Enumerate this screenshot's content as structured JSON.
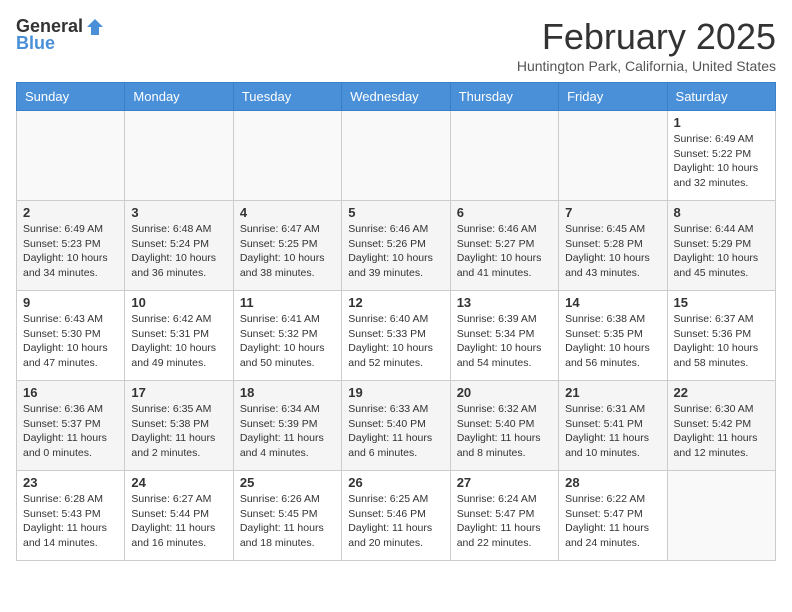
{
  "header": {
    "logo_general": "General",
    "logo_blue": "Blue",
    "month_title": "February 2025",
    "location": "Huntington Park, California, United States"
  },
  "weekdays": [
    "Sunday",
    "Monday",
    "Tuesday",
    "Wednesday",
    "Thursday",
    "Friday",
    "Saturday"
  ],
  "weeks": [
    [
      {
        "day": "",
        "info": ""
      },
      {
        "day": "",
        "info": ""
      },
      {
        "day": "",
        "info": ""
      },
      {
        "day": "",
        "info": ""
      },
      {
        "day": "",
        "info": ""
      },
      {
        "day": "",
        "info": ""
      },
      {
        "day": "1",
        "info": "Sunrise: 6:49 AM\nSunset: 5:22 PM\nDaylight: 10 hours and 32 minutes."
      }
    ],
    [
      {
        "day": "2",
        "info": "Sunrise: 6:49 AM\nSunset: 5:23 PM\nDaylight: 10 hours and 34 minutes."
      },
      {
        "day": "3",
        "info": "Sunrise: 6:48 AM\nSunset: 5:24 PM\nDaylight: 10 hours and 36 minutes."
      },
      {
        "day": "4",
        "info": "Sunrise: 6:47 AM\nSunset: 5:25 PM\nDaylight: 10 hours and 38 minutes."
      },
      {
        "day": "5",
        "info": "Sunrise: 6:46 AM\nSunset: 5:26 PM\nDaylight: 10 hours and 39 minutes."
      },
      {
        "day": "6",
        "info": "Sunrise: 6:46 AM\nSunset: 5:27 PM\nDaylight: 10 hours and 41 minutes."
      },
      {
        "day": "7",
        "info": "Sunrise: 6:45 AM\nSunset: 5:28 PM\nDaylight: 10 hours and 43 minutes."
      },
      {
        "day": "8",
        "info": "Sunrise: 6:44 AM\nSunset: 5:29 PM\nDaylight: 10 hours and 45 minutes."
      }
    ],
    [
      {
        "day": "9",
        "info": "Sunrise: 6:43 AM\nSunset: 5:30 PM\nDaylight: 10 hours and 47 minutes."
      },
      {
        "day": "10",
        "info": "Sunrise: 6:42 AM\nSunset: 5:31 PM\nDaylight: 10 hours and 49 minutes."
      },
      {
        "day": "11",
        "info": "Sunrise: 6:41 AM\nSunset: 5:32 PM\nDaylight: 10 hours and 50 minutes."
      },
      {
        "day": "12",
        "info": "Sunrise: 6:40 AM\nSunset: 5:33 PM\nDaylight: 10 hours and 52 minutes."
      },
      {
        "day": "13",
        "info": "Sunrise: 6:39 AM\nSunset: 5:34 PM\nDaylight: 10 hours and 54 minutes."
      },
      {
        "day": "14",
        "info": "Sunrise: 6:38 AM\nSunset: 5:35 PM\nDaylight: 10 hours and 56 minutes."
      },
      {
        "day": "15",
        "info": "Sunrise: 6:37 AM\nSunset: 5:36 PM\nDaylight: 10 hours and 58 minutes."
      }
    ],
    [
      {
        "day": "16",
        "info": "Sunrise: 6:36 AM\nSunset: 5:37 PM\nDaylight: 11 hours and 0 minutes."
      },
      {
        "day": "17",
        "info": "Sunrise: 6:35 AM\nSunset: 5:38 PM\nDaylight: 11 hours and 2 minutes."
      },
      {
        "day": "18",
        "info": "Sunrise: 6:34 AM\nSunset: 5:39 PM\nDaylight: 11 hours and 4 minutes."
      },
      {
        "day": "19",
        "info": "Sunrise: 6:33 AM\nSunset: 5:40 PM\nDaylight: 11 hours and 6 minutes."
      },
      {
        "day": "20",
        "info": "Sunrise: 6:32 AM\nSunset: 5:40 PM\nDaylight: 11 hours and 8 minutes."
      },
      {
        "day": "21",
        "info": "Sunrise: 6:31 AM\nSunset: 5:41 PM\nDaylight: 11 hours and 10 minutes."
      },
      {
        "day": "22",
        "info": "Sunrise: 6:30 AM\nSunset: 5:42 PM\nDaylight: 11 hours and 12 minutes."
      }
    ],
    [
      {
        "day": "23",
        "info": "Sunrise: 6:28 AM\nSunset: 5:43 PM\nDaylight: 11 hours and 14 minutes."
      },
      {
        "day": "24",
        "info": "Sunrise: 6:27 AM\nSunset: 5:44 PM\nDaylight: 11 hours and 16 minutes."
      },
      {
        "day": "25",
        "info": "Sunrise: 6:26 AM\nSunset: 5:45 PM\nDaylight: 11 hours and 18 minutes."
      },
      {
        "day": "26",
        "info": "Sunrise: 6:25 AM\nSunset: 5:46 PM\nDaylight: 11 hours and 20 minutes."
      },
      {
        "day": "27",
        "info": "Sunrise: 6:24 AM\nSunset: 5:47 PM\nDaylight: 11 hours and 22 minutes."
      },
      {
        "day": "28",
        "info": "Sunrise: 6:22 AM\nSunset: 5:47 PM\nDaylight: 11 hours and 24 minutes."
      },
      {
        "day": "",
        "info": ""
      }
    ]
  ]
}
